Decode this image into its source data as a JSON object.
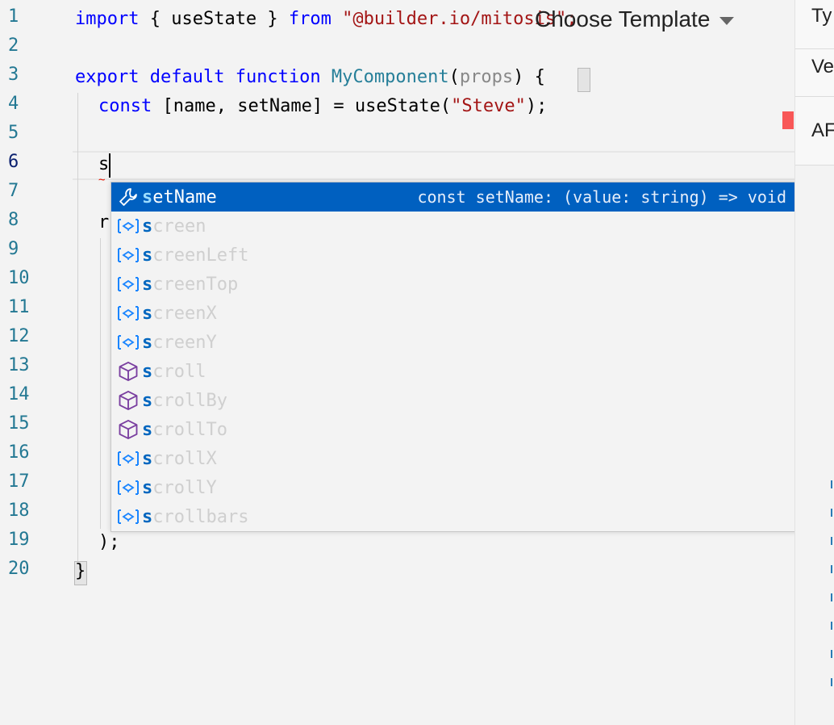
{
  "template_picker": {
    "label": "Choose Template"
  },
  "right_panel": {
    "items": [
      "Ty",
      "Ve",
      "AF"
    ]
  },
  "editor": {
    "line_numbers": [
      "1",
      "2",
      "3",
      "4",
      "5",
      "6",
      "7",
      "8",
      "9",
      "10",
      "11",
      "12",
      "13",
      "14",
      "15",
      "16",
      "17",
      "18",
      "19",
      "20"
    ],
    "active_line": "6",
    "lines": {
      "l1": {
        "import": "import",
        "braces": " { useState } ",
        "from": "from",
        "module": " \"@builder.io/mitosis\";"
      },
      "l3": {
        "export": "export",
        "default": " default",
        "function": " function",
        "name": " MyComponent",
        "open": "(",
        "props": "props",
        "close": ") {"
      },
      "l4": {
        "const": "const",
        "rest1": " [name, setName] = useState(",
        "str": "\"Steve\"",
        "rest2": ");"
      },
      "l6": {
        "text": "s"
      },
      "l8": {
        "text": "r"
      },
      "l19": {
        "text": ");"
      },
      "l20": {
        "text": "}"
      }
    }
  },
  "suggestions": {
    "typed_prefix": "s",
    "selected_detail": "const setName: (value: string) => void",
    "items": [
      {
        "icon": "wrench-icon",
        "label_rest": "etName"
      },
      {
        "icon": "variable-icon",
        "label_rest": "creen"
      },
      {
        "icon": "variable-icon",
        "label_rest": "creenLeft"
      },
      {
        "icon": "variable-icon",
        "label_rest": "creenTop"
      },
      {
        "icon": "variable-icon",
        "label_rest": "creenX"
      },
      {
        "icon": "variable-icon",
        "label_rest": "creenY"
      },
      {
        "icon": "method-cube-icon",
        "label_rest": "croll"
      },
      {
        "icon": "method-cube-icon",
        "label_rest": "crollBy"
      },
      {
        "icon": "method-cube-icon",
        "label_rest": "crollTo"
      },
      {
        "icon": "variable-icon",
        "label_rest": "crollX"
      },
      {
        "icon": "variable-icon",
        "label_rest": "crollY"
      },
      {
        "icon": "variable-icon",
        "label_rest": "crollbars"
      }
    ]
  },
  "colors": {
    "selection": "#0060c0",
    "error_marker": "#f85757",
    "keyword": "#0000ff",
    "string": "#a31515",
    "type": "#267f99"
  }
}
